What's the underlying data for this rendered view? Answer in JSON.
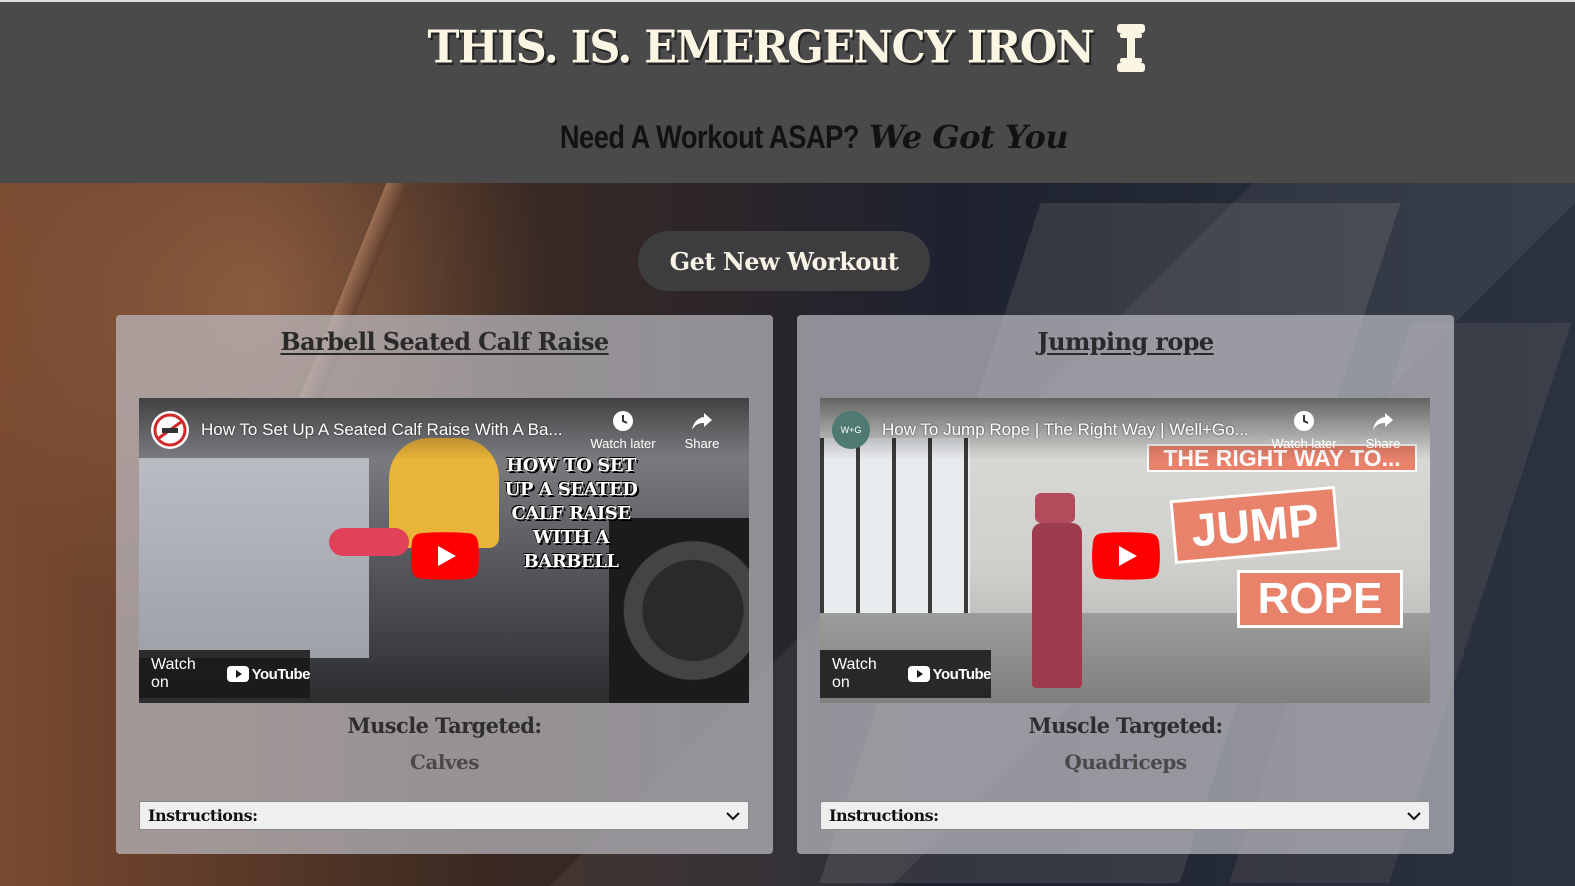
{
  "header": {
    "title": "THIS. IS. EMERGENCY IRON",
    "tagline_main": "Need A Workout ASAP?",
    "tagline_emphasis": "We Got You"
  },
  "cta": {
    "label": "Get New Workout"
  },
  "workouts": [
    {
      "name": "Barbell Seated Calf Raise",
      "video": {
        "title": "How To Set Up A Seated Calf Raise With A Ba...",
        "watch_later": "Watch later",
        "share": "Share",
        "watch_on": "Watch on",
        "youtube": "YouTube",
        "overlay_text": "HOW TO SET UP A SEATED CALF RAISE WITH A BARBELL"
      },
      "muscle_label": "Muscle Targeted:",
      "muscle": "Calves",
      "instructions_label": "Instructions:"
    },
    {
      "name": "Jumping rope",
      "video": {
        "title": "How To Jump Rope | The Right Way | Well+Go...",
        "channel": "W+G",
        "watch_later": "Watch later",
        "share": "Share",
        "watch_on": "Watch on",
        "youtube": "YouTube",
        "overlay_banner": "THE RIGHT WAY TO...",
        "overlay_word_1": "JUMP",
        "overlay_word_2": "ROPE"
      },
      "muscle_label": "Muscle Targeted:",
      "muscle": "Quadriceps",
      "instructions_label": "Instructions:"
    }
  ],
  "colors": {
    "header_bg": "#4a4a4b",
    "title": "#fbf6e4",
    "button_bg": "#3d3d3f",
    "youtube_red": "#ff0000",
    "overlay_salmon": "#e8826b"
  }
}
